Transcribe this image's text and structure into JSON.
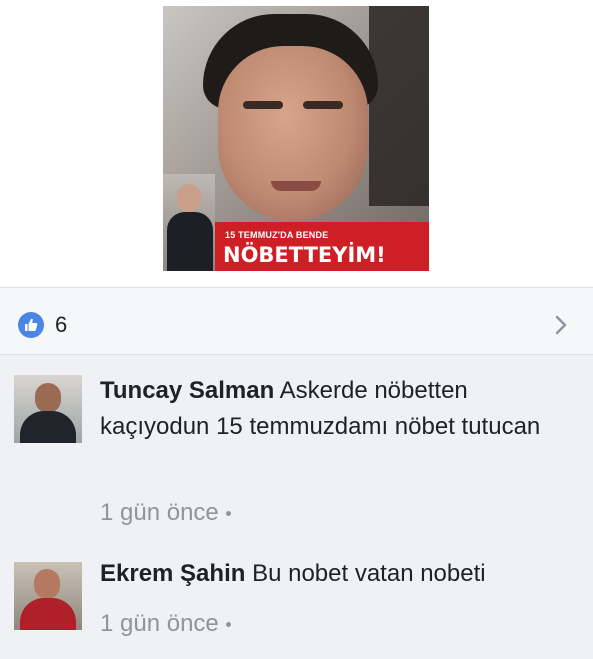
{
  "post": {
    "image": {
      "banner_small_text": "15 TEMMUZ'DA BENDE",
      "banner_big_text": "NÖBETTEYİM!"
    }
  },
  "reactions": {
    "like_icon": "thumbs-up-icon",
    "like_count": "6",
    "chevron_icon": "chevron-right-icon"
  },
  "comments": [
    {
      "author": "Tuncay Salman",
      "text": "Askerde nöbetten kaçıyodun 15 temmuzdamı nöbet tutucan",
      "time": "1 gün önce"
    },
    {
      "author": "Ekrem Şahin",
      "text": "Bu nobet vatan nobeti",
      "time": "1 gün önce"
    }
  ],
  "colors": {
    "like_blue": "#4b85e6",
    "banner_red": "#cf1f26",
    "meta_gray": "#90949c",
    "comment_bg": "#f0f1f4"
  }
}
